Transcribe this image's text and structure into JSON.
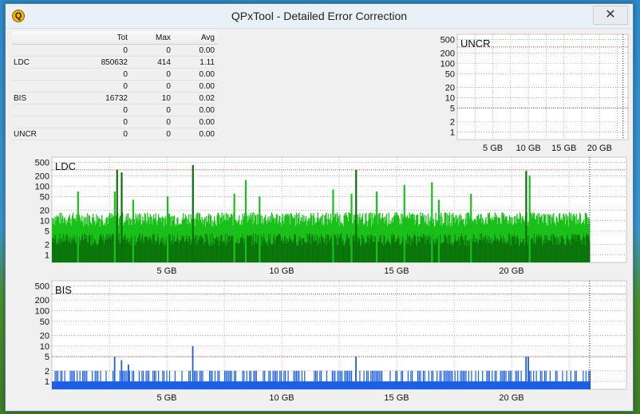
{
  "window": {
    "title": "QPxTool - Detailed Error Correction",
    "app_icon": "Q",
    "close_glyph": "✕"
  },
  "stats": {
    "headers": [
      "",
      "Tot",
      "Max",
      "Avg"
    ],
    "rows": [
      {
        "label": "",
        "tot": "0",
        "max": "0",
        "avg": "0.00"
      },
      {
        "label": "LDC",
        "tot": "850632",
        "max": "414",
        "avg": "1.11"
      },
      {
        "label": "",
        "tot": "0",
        "max": "0",
        "avg": "0.00"
      },
      {
        "label": "",
        "tot": "0",
        "max": "0",
        "avg": "0.00"
      },
      {
        "label": "BIS",
        "tot": "16732",
        "max": "10",
        "avg": "0.02"
      },
      {
        "label": "",
        "tot": "0",
        "max": "0",
        "avg": "0.00"
      },
      {
        "label": "",
        "tot": "0",
        "max": "0",
        "avg": "0.00"
      },
      {
        "label": "UNCR",
        "tot": "0",
        "max": "0",
        "avg": "0.00"
      }
    ]
  },
  "colors": {
    "ldc_bright": "#19c019",
    "ldc_dark": "#0a6e0a",
    "bis": "#1a5fe6",
    "threshold": "#d03030",
    "grid": "#888888"
  },
  "chart_data": [
    {
      "type": "bar",
      "title": "UNCR",
      "scale": "log",
      "y_ticks": [
        500,
        200,
        100,
        50,
        20,
        10,
        5,
        2,
        1
      ],
      "x_ticks": [
        "5 GB",
        "10 GB",
        "15 GB",
        "20 GB"
      ],
      "xlim": [
        0,
        24
      ],
      "ylim": [
        0.6,
        700
      ],
      "threshold": 300,
      "end_marker": 23.3,
      "values": []
    },
    {
      "type": "bar",
      "title": "LDC",
      "scale": "log",
      "y_ticks": [
        500,
        200,
        100,
        50,
        20,
        10,
        5,
        2,
        1
      ],
      "x_ticks": [
        "5 GB",
        "10 GB",
        "15 GB",
        "20 GB"
      ],
      "xlim": [
        0,
        25
      ],
      "ylim": [
        0.6,
        700
      ],
      "threshold": 300,
      "end_marker": 23.4,
      "baseline_level": 12,
      "lower_level": 3,
      "max": 414,
      "spikes": [
        {
          "x": 1.1,
          "y": 70
        },
        {
          "x": 2.7,
          "y": 70
        },
        {
          "x": 2.8,
          "y": 300
        },
        {
          "x": 3.0,
          "y": 250
        },
        {
          "x": 3.5,
          "y": 40
        },
        {
          "x": 5.0,
          "y": 50
        },
        {
          "x": 6.1,
          "y": 414
        },
        {
          "x": 7.9,
          "y": 60
        },
        {
          "x": 8.4,
          "y": 150
        },
        {
          "x": 9.0,
          "y": 50
        },
        {
          "x": 12.2,
          "y": 80
        },
        {
          "x": 13.0,
          "y": 60
        },
        {
          "x": 13.2,
          "y": 300
        },
        {
          "x": 14.1,
          "y": 70
        },
        {
          "x": 15.3,
          "y": 110
        },
        {
          "x": 16.5,
          "y": 130
        },
        {
          "x": 16.8,
          "y": 40
        },
        {
          "x": 18.2,
          "y": 60
        },
        {
          "x": 20.6,
          "y": 280
        },
        {
          "x": 20.75,
          "y": 200
        }
      ]
    },
    {
      "type": "bar",
      "title": "BIS",
      "scale": "log",
      "y_ticks": [
        500,
        200,
        100,
        50,
        20,
        10,
        5,
        2,
        1
      ],
      "x_ticks": [
        "5 GB",
        "10 GB",
        "15 GB",
        "20 GB"
      ],
      "xlim": [
        0,
        25
      ],
      "ylim": [
        0.6,
        700
      ],
      "threshold": 300,
      "threshold_low": 5,
      "end_marker": 23.4,
      "baseline_level": 1,
      "typical_level": 2,
      "max": 10,
      "spikes": [
        {
          "x": 2.7,
          "y": 5
        },
        {
          "x": 3.0,
          "y": 4
        },
        {
          "x": 3.3,
          "y": 3
        },
        {
          "x": 6.1,
          "y": 10
        },
        {
          "x": 13.2,
          "y": 5
        },
        {
          "x": 20.6,
          "y": 5
        },
        {
          "x": 20.7,
          "y": 5
        }
      ]
    }
  ]
}
